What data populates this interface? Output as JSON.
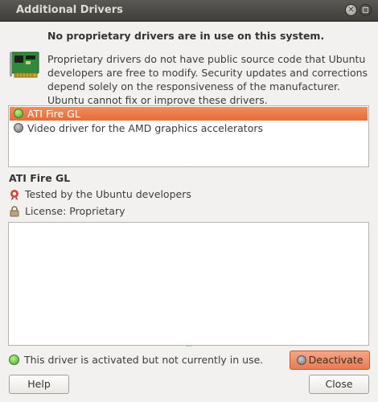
{
  "window": {
    "title": "Additional Drivers",
    "close_icon": "close-icon",
    "maximize_icon": "maximize-icon"
  },
  "header": {
    "heading": "No proprietary drivers are in use on this system.",
    "icon": "expansion-card-icon",
    "description": "Proprietary drivers do not have public source code that Ubuntu developers are free to modify. Security updates and corrections depend solely on the responsiveness of the manufacturer. Ubuntu cannot fix or improve these drivers."
  },
  "drivers": {
    "items": [
      {
        "label": "ATI Fire GL",
        "status": "green",
        "selected": true
      },
      {
        "label": "Video driver for the AMD graphics accelerators",
        "status": "gray",
        "selected": false
      }
    ]
  },
  "details": {
    "name": "ATI Fire GL",
    "tested": "Tested by the Ubuntu developers",
    "tested_icon": "ubuntu-badge-icon",
    "license": "License:  Proprietary",
    "license_icon": "lock-icon",
    "notes": ""
  },
  "status": {
    "text": "This driver is activated but not currently in use.",
    "icon": "status-green-icon"
  },
  "buttons": {
    "deactivate": "Deactivate",
    "help": "Help",
    "close": "Close"
  },
  "colors": {
    "titlebar": "#403f3b",
    "selection": "#e56d38",
    "accent_button": "#e77c54"
  }
}
